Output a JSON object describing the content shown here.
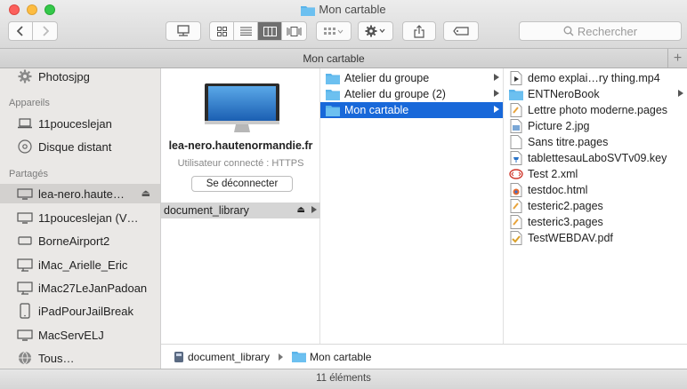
{
  "window": {
    "title": "Mon cartable"
  },
  "toolbar": {
    "search_placeholder": "Rechercher"
  },
  "tabbar": {
    "title": "Mon cartable",
    "add": "+"
  },
  "sidebar": {
    "top_item": "Photosjpg",
    "sections": [
      {
        "heading": "Appareils",
        "items": [
          "11pouceslejan",
          "Disque distant"
        ]
      },
      {
        "heading": "Partagés",
        "items": [
          "lea-nero.haute…",
          "11pouceslejan (V…",
          "BorneAirport2",
          "iMac_Arielle_Eric",
          "iMac27LeJanPadoan",
          "iPadPourJailBreak",
          "MacServELJ",
          "Tous…"
        ]
      }
    ],
    "eject_symbol": "⏏"
  },
  "server": {
    "name": "lea-nero.hautenormandie.fr",
    "user": "Utilisateur connecté : HTTPS",
    "disconnect_label": "Se déconnecter",
    "share": "document_library"
  },
  "column2": {
    "items": [
      "Atelier du groupe",
      "Atelier du groupe (2)",
      "Mon cartable"
    ],
    "selected_index": 2
  },
  "column3": {
    "items": [
      {
        "label": "demo explai…ry thing.mp4",
        "icon": "movie-icon"
      },
      {
        "label": "ENTNeroBook",
        "icon": "folder-icon"
      },
      {
        "label": "Lettre photo moderne.pages",
        "icon": "pages-icon"
      },
      {
        "label": "Picture 2.jpg",
        "icon": "image-icon"
      },
      {
        "label": "Sans titre.pages",
        "icon": "blank-doc-icon"
      },
      {
        "label": "tablettesauLaboSVTv09.key",
        "icon": "keynote-icon"
      },
      {
        "label": "Test 2.xml",
        "icon": "xml-icon"
      },
      {
        "label": "testdoc.html",
        "icon": "html-icon"
      },
      {
        "label": "testeric2.pages",
        "icon": "pages-icon"
      },
      {
        "label": "testeric3.pages",
        "icon": "pages-icon"
      },
      {
        "label": "TestWEBDAV.pdf",
        "icon": "pdf-icon"
      }
    ]
  },
  "pathbar": {
    "items": [
      "document_library",
      "Mon cartable"
    ]
  },
  "status": {
    "text": "11 éléments"
  },
  "colors": {
    "selection": "#1868d9",
    "folder": "#5ab4ea",
    "sidebar_bg": "#eae8e6"
  }
}
